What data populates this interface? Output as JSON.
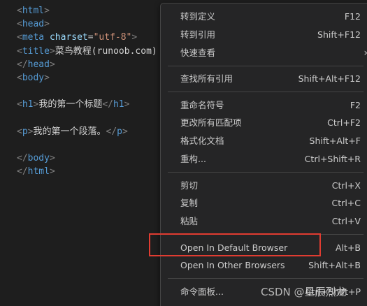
{
  "editor": {
    "lines": [
      {
        "parts": [
          {
            "c": "p",
            "t": "<"
          },
          {
            "c": "t",
            "t": "html"
          },
          {
            "c": "p",
            "t": ">"
          }
        ]
      },
      {
        "parts": [
          {
            "c": "p",
            "t": "<"
          },
          {
            "c": "t",
            "t": "head"
          },
          {
            "c": "p",
            "t": ">"
          }
        ]
      },
      {
        "parts": [
          {
            "c": "p",
            "t": "<"
          },
          {
            "c": "t",
            "t": "meta"
          },
          {
            "c": "x",
            "t": " "
          },
          {
            "c": "a",
            "t": "charset"
          },
          {
            "c": "x",
            "t": "="
          },
          {
            "c": "s",
            "t": "\"utf-8\""
          },
          {
            "c": "p",
            "t": ">"
          }
        ]
      },
      {
        "parts": [
          {
            "c": "p",
            "t": "<"
          },
          {
            "c": "t",
            "t": "title"
          },
          {
            "c": "p",
            "t": ">"
          },
          {
            "c": "x",
            "t": "菜鸟教程(runoob.com)"
          }
        ]
      },
      {
        "parts": [
          {
            "c": "p",
            "t": "</"
          },
          {
            "c": "t",
            "t": "head"
          },
          {
            "c": "p",
            "t": ">"
          }
        ]
      },
      {
        "parts": [
          {
            "c": "p",
            "t": "<"
          },
          {
            "c": "t",
            "t": "body"
          },
          {
            "c": "p",
            "t": ">"
          }
        ]
      },
      {
        "parts": []
      },
      {
        "parts": [
          {
            "c": "p",
            "t": "<"
          },
          {
            "c": "t",
            "t": "h1"
          },
          {
            "c": "p",
            "t": ">"
          },
          {
            "c": "x",
            "t": "我的第一个标题"
          },
          {
            "c": "p",
            "t": "</"
          },
          {
            "c": "t",
            "t": "h1"
          },
          {
            "c": "p",
            "t": ">"
          }
        ]
      },
      {
        "parts": []
      },
      {
        "parts": [
          {
            "c": "p",
            "t": "<"
          },
          {
            "c": "t",
            "t": "p"
          },
          {
            "c": "p",
            "t": ">"
          },
          {
            "c": "x",
            "t": "我的第一个段落。"
          },
          {
            "c": "p",
            "t": "</"
          },
          {
            "c": "t",
            "t": "p"
          },
          {
            "c": "p",
            "t": ">"
          }
        ]
      },
      {
        "parts": []
      },
      {
        "parts": [
          {
            "c": "p",
            "t": "</"
          },
          {
            "c": "t",
            "t": "body"
          },
          {
            "c": "p",
            "t": ">"
          }
        ]
      },
      {
        "parts": [
          {
            "c": "p",
            "t": "</"
          },
          {
            "c": "t",
            "t": "html"
          },
          {
            "c": "p",
            "t": ">"
          }
        ]
      }
    ]
  },
  "context_menu": {
    "items": [
      {
        "label": "转到定义",
        "shortcut": "F12"
      },
      {
        "label": "转到引用",
        "shortcut": "Shift+F12"
      },
      {
        "label": "快速查看",
        "submenu": "›"
      },
      {
        "label": "查找所有引用",
        "shortcut": "Shift+Alt+F12"
      },
      {
        "label": "重命名符号",
        "shortcut": "F2"
      },
      {
        "label": "更改所有匹配项",
        "shortcut": "Ctrl+F2"
      },
      {
        "label": "格式化文档",
        "shortcut": "Shift+Alt+F"
      },
      {
        "label": "重构...",
        "shortcut": "Ctrl+Shift+R"
      },
      {
        "label": "剪切",
        "shortcut": "Ctrl+X"
      },
      {
        "label": "复制",
        "shortcut": "Ctrl+C"
      },
      {
        "label": "粘贴",
        "shortcut": "Ctrl+V"
      },
      {
        "label": "Open In Default Browser",
        "shortcut": "Alt+B"
      },
      {
        "label": "Open In Other Browsers",
        "shortcut": "Shift+Alt+B"
      },
      {
        "label": "命令面板...",
        "shortcut": "Ctrl+Shift+P"
      }
    ]
  },
  "watermark": "CSDN @星辰烈龙",
  "colors": {
    "highlight_border": "#e03c31",
    "menu_bg": "#252526",
    "editor_bg": "#1e1e1e"
  }
}
